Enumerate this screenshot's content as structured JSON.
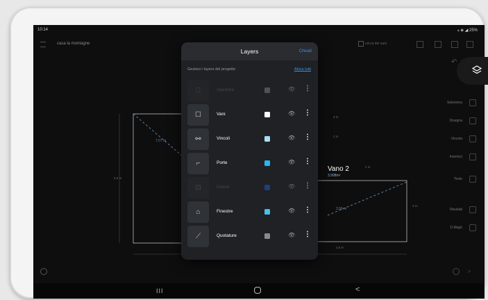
{
  "status": {
    "time": "10:14",
    "indicators": "⁎ ◈ ◢ 25%"
  },
  "appbar": {
    "title": "casa la montagne",
    "search_label": "cerca dei vani"
  },
  "plan": {
    "room_name": "Vano 2",
    "room_area": "3,998m²",
    "dimensions": [
      "5,9 m",
      "3 m",
      "2 m",
      "2 m",
      "3 m",
      "3,9 m",
      "3 m"
    ],
    "diagonals": [
      "7,07 m",
      "3,58 m"
    ]
  },
  "rail": [
    {
      "label": "Seleziona",
      "icon": "select-icon"
    },
    {
      "label": "Disegna",
      "icon": "pencil-icon"
    },
    {
      "label": "Vincola",
      "icon": "constraint-icon"
    },
    {
      "label": "Inserisci",
      "icon": "plus-icon"
    },
    {
      "label": "Testo",
      "icon": "text-icon"
    },
    {
      "label": "Risultati",
      "icon": "results-icon"
    },
    {
      "label": "D.Magh",
      "icon": "magnet-icon"
    }
  ],
  "panel": {
    "title": "Layers",
    "close_label": "Chiudi",
    "subtitle": "Gestisci i layers del progetto",
    "activate_all_label": "Attiva tutti",
    "layers": [
      {
        "name": "Aperture",
        "color": "#7a7a7a",
        "active": false,
        "icon": "opening-icon"
      },
      {
        "name": "Vani",
        "color": "#ffffff",
        "active": true,
        "icon": "room-icon"
      },
      {
        "name": "Vincoli",
        "color": "#a9def2",
        "active": true,
        "icon": "link-icon"
      },
      {
        "name": "Porte",
        "color": "#29b6f2",
        "active": true,
        "icon": "door-icon"
      },
      {
        "name": "Unioni",
        "color": "#1e5bbf",
        "active": false,
        "icon": "union-icon"
      },
      {
        "name": "Finestre",
        "color": "#46c0ea",
        "active": true,
        "icon": "window-icon"
      },
      {
        "name": "Quotature",
        "color": "#8a8a8a",
        "active": true,
        "icon": "measure-icon"
      }
    ]
  },
  "navbar": {
    "recent": "III",
    "home": "",
    "back": "<"
  }
}
